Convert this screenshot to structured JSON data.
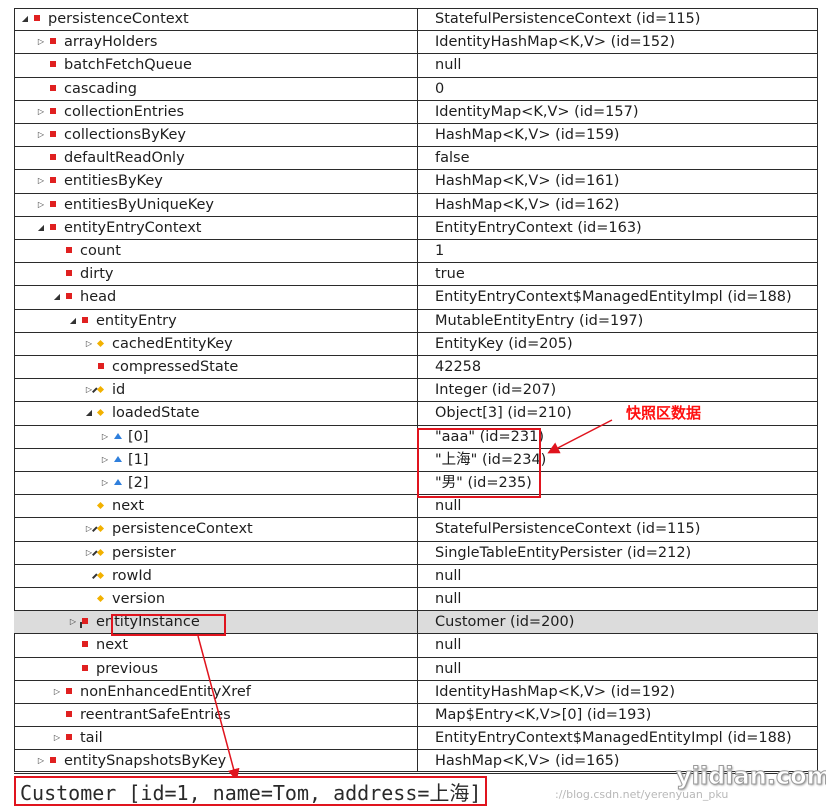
{
  "rows": [
    {
      "indent": 0,
      "arrow": "expanded",
      "icon": "sq",
      "name": "persistenceContext",
      "value": "StatefulPersistenceContext  (id=115)"
    },
    {
      "indent": 1,
      "arrow": "collapsed",
      "icon": "sq",
      "name": "arrayHolders",
      "value": "IdentityHashMap<K,V>  (id=152)"
    },
    {
      "indent": 1,
      "arrow": "none",
      "icon": "sq",
      "name": "batchFetchQueue",
      "value": "null"
    },
    {
      "indent": 1,
      "arrow": "none",
      "icon": "sq",
      "name": "cascading",
      "value": "0"
    },
    {
      "indent": 1,
      "arrow": "collapsed",
      "icon": "sq",
      "name": "collectionEntries",
      "value": "IdentityMap<K,V>  (id=157)"
    },
    {
      "indent": 1,
      "arrow": "collapsed",
      "icon": "sq",
      "name": "collectionsByKey",
      "value": "HashMap<K,V>  (id=159)"
    },
    {
      "indent": 1,
      "arrow": "none",
      "icon": "sq",
      "name": "defaultReadOnly",
      "value": "false"
    },
    {
      "indent": 1,
      "arrow": "collapsed",
      "icon": "sq",
      "name": "entitiesByKey",
      "value": "HashMap<K,V>  (id=161)"
    },
    {
      "indent": 1,
      "arrow": "collapsed",
      "icon": "sq",
      "name": "entitiesByUniqueKey",
      "value": "HashMap<K,V>  (id=162)"
    },
    {
      "indent": 1,
      "arrow": "expanded",
      "icon": "sq",
      "name": "entityEntryContext",
      "value": "EntityEntryContext  (id=163)"
    },
    {
      "indent": 2,
      "arrow": "none",
      "icon": "sq",
      "name": "count",
      "value": "1"
    },
    {
      "indent": 2,
      "arrow": "none",
      "icon": "sq",
      "name": "dirty",
      "value": "true"
    },
    {
      "indent": 2,
      "arrow": "expanded",
      "icon": "sq",
      "name": "head",
      "value": "EntityEntryContext$ManagedEntityImpl  (id=188)"
    },
    {
      "indent": 3,
      "arrow": "expanded",
      "icon": "sq",
      "name": "entityEntry",
      "value": "MutableEntityEntry  (id=197)"
    },
    {
      "indent": 4,
      "arrow": "collapsed",
      "icon": "dia",
      "name": "cachedEntityKey",
      "value": "EntityKey  (id=205)"
    },
    {
      "indent": 4,
      "arrow": "none",
      "icon": "sq",
      "name": "compressedState",
      "value": "42258"
    },
    {
      "indent": 4,
      "arrow": "collapsed",
      "icon": "diaf",
      "name": "id",
      "value": "Integer  (id=207)"
    },
    {
      "indent": 4,
      "arrow": "expanded",
      "icon": "dia",
      "name": "loadedState",
      "value": "Object[3]  (id=210)"
    },
    {
      "indent": 5,
      "arrow": "collapsed",
      "icon": "tri",
      "name": "[0]",
      "value": "\"aaa\"  (id=231)"
    },
    {
      "indent": 5,
      "arrow": "collapsed",
      "icon": "tri",
      "name": "[1]",
      "value": "\"上海\"  (id=234)"
    },
    {
      "indent": 5,
      "arrow": "collapsed",
      "icon": "tri",
      "name": "[2]",
      "value": "\"男\"  (id=235)"
    },
    {
      "indent": 4,
      "arrow": "none",
      "icon": "dia",
      "name": "next",
      "value": "null"
    },
    {
      "indent": 4,
      "arrow": "collapsed",
      "icon": "diaf",
      "name": "persistenceContext",
      "value": "StatefulPersistenceContext  (id=115)"
    },
    {
      "indent": 4,
      "arrow": "collapsed",
      "icon": "diaf",
      "name": "persister",
      "value": "SingleTableEntityPersister  (id=212)"
    },
    {
      "indent": 4,
      "arrow": "none",
      "icon": "diaf",
      "name": "rowId",
      "value": "null"
    },
    {
      "indent": 4,
      "arrow": "none",
      "icon": "dia",
      "name": "version",
      "value": "null"
    },
    {
      "indent": 3,
      "arrow": "collapsed",
      "icon": "sqf",
      "name": "entityInstance",
      "value": "Customer  (id=200)",
      "selected": true
    },
    {
      "indent": 3,
      "arrow": "none",
      "icon": "sq",
      "name": "next",
      "value": "null"
    },
    {
      "indent": 3,
      "arrow": "none",
      "icon": "sq",
      "name": "previous",
      "value": "null"
    },
    {
      "indent": 2,
      "arrow": "collapsed",
      "icon": "sq",
      "name": "nonEnhancedEntityXref",
      "value": "IdentityHashMap<K,V>  (id=192)"
    },
    {
      "indent": 2,
      "arrow": "none",
      "icon": "sq",
      "name": "reentrantSafeEntries",
      "value": "Map$Entry<K,V>[0]  (id=193)"
    },
    {
      "indent": 2,
      "arrow": "collapsed",
      "icon": "sq",
      "name": "tail",
      "value": "EntityEntryContext$ManagedEntityImpl  (id=188)"
    },
    {
      "indent": 1,
      "arrow": "collapsed",
      "icon": "sq",
      "name": "entitySnapshotsByKey",
      "value": "HashMap<K,V>  (id=165)"
    }
  ],
  "annotation": "快照区数据",
  "console_output": "Customer [id=1, name=Tom, address=上海]",
  "watermark": "yiidian.com",
  "watermark_url": "://blog.csdn.net/yerenyuan_pku",
  "colors": {
    "highlight": "#e0141e",
    "annotation": "#ff1010",
    "field_icon": "#e02020",
    "static_icon": "#f2b100",
    "array_icon": "#2f7fdc",
    "selected_row": "#dcdcdc"
  }
}
